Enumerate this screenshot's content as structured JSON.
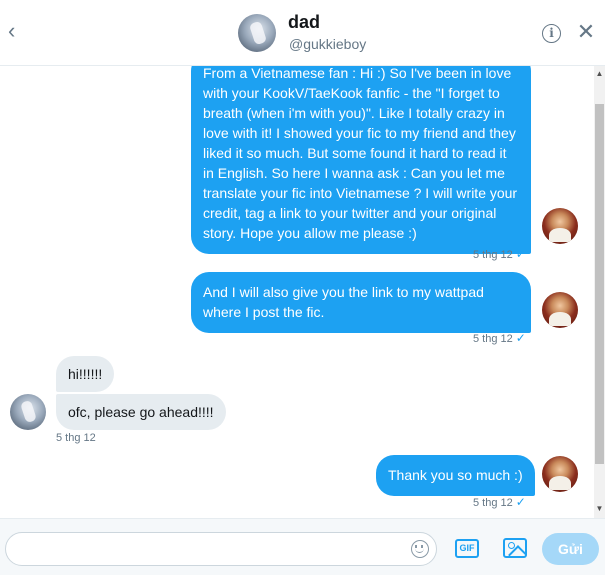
{
  "header": {
    "back_icon": "chevron-left-icon",
    "name": "dad",
    "handle": "@gukkieboy",
    "info_icon": "info-icon",
    "close_icon": "close-icon"
  },
  "messages": [
    {
      "from": "me",
      "text": "From a Vietnamese fan : Hi :) So I've been in love with your KookV/TaeKook fanfic - the \"I forget to breath (when i'm with you)\". Like I totally crazy in love with it! I showed your fic to my friend and they liked it so much. But some found it hard to read it in English. So here I wanna ask : Can you let me translate your fic into Vietnamese ? I will write your credit, tag a link to your twitter and your original story. Hope you allow me please :)",
      "time": "5 thg 12",
      "status": "✓"
    },
    {
      "from": "me",
      "text": "And I will also give you the link to my wattpad where I post the fic.",
      "time": "5 thg 12",
      "status": "✓"
    },
    {
      "from": "them",
      "text": "hi!!!!!!"
    },
    {
      "from": "them",
      "text": "ofc, please go ahead!!!!",
      "time": "5 thg 12"
    },
    {
      "from": "me",
      "text": "Thank you so much :)",
      "time": "5 thg 12",
      "status": "✓"
    }
  ],
  "composer": {
    "placeholder": "",
    "value": "",
    "emoji_icon": "emoji-icon",
    "gif_label": "GIF",
    "image_icon": "image-icon",
    "send_label": "Gửi"
  },
  "colors": {
    "accent": "#1da1f2",
    "incoming_bubble": "#e6ecf0",
    "send_disabled": "#a5d8f8",
    "muted_text": "#657786"
  }
}
